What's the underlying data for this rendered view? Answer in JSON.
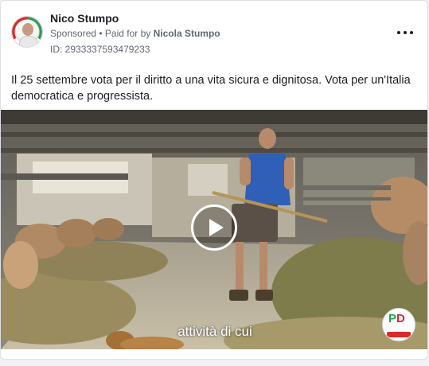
{
  "post": {
    "author_name": "Nico Stumpo",
    "sponsored_label": "Sponsored",
    "separator": " • ",
    "paid_for_prefix": "Paid for by ",
    "paid_for_name": "Nicola Stumpo",
    "ad_id": "ID: 2933337593479233",
    "text": "Il 25 settembre vota per il diritto a una vita sicura e dignitosa. Vota per un'Italia democratica e progressista.",
    "menu_icon": "more-options-icon"
  },
  "video": {
    "subtitle": "attività di cui",
    "play_icon": "play-icon",
    "logo_letters_p": "P",
    "logo_letters_d": "D"
  },
  "colors": {
    "card_bg": "#ffffff",
    "page_bg": "#f0f2f5",
    "text_primary": "#1c1e21",
    "text_secondary": "#606770",
    "pd_green": "#2e9e4f",
    "pd_red": "#d92b2b"
  }
}
